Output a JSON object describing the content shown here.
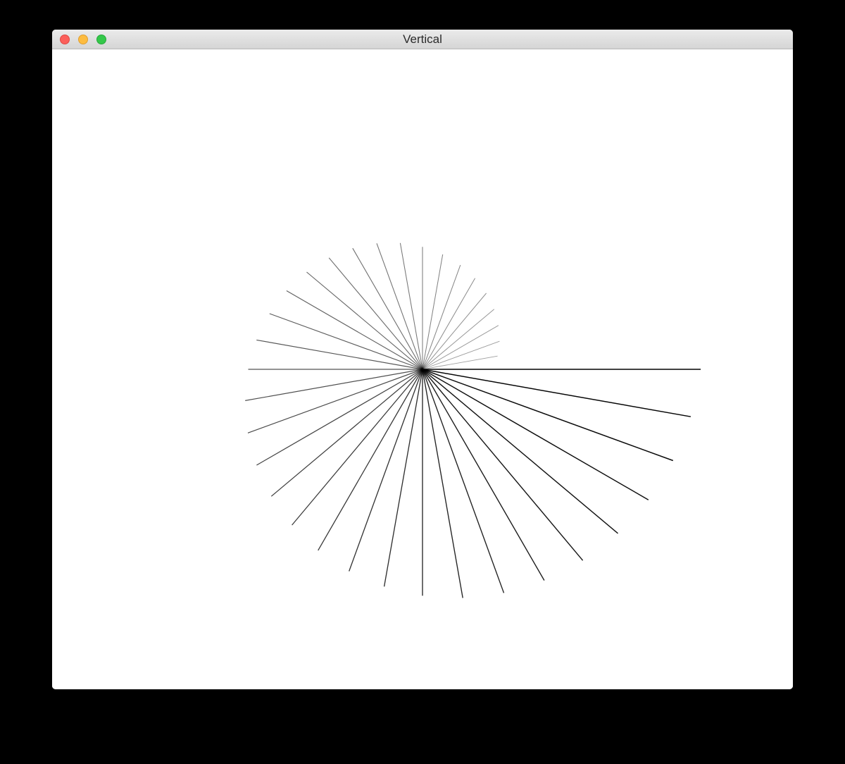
{
  "window": {
    "title": "Vertical"
  },
  "drawing": {
    "line_color": "#000000",
    "line_count": 36,
    "description_colors": {
      "light_lines": "#888888",
      "dark_lines": "#000000"
    }
  }
}
